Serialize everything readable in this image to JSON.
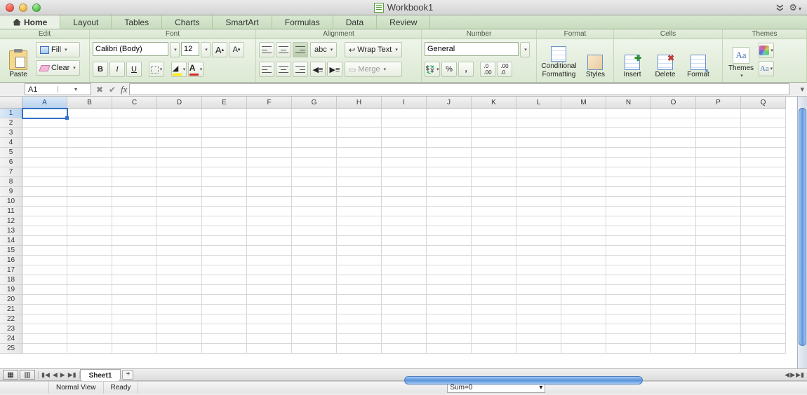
{
  "window": {
    "title": "Workbook1"
  },
  "tabs": [
    "Home",
    "Layout",
    "Tables",
    "Charts",
    "SmartArt",
    "Formulas",
    "Data",
    "Review"
  ],
  "active_tab": "Home",
  "groups": {
    "edit": "Edit",
    "font": "Font",
    "alignment": "Alignment",
    "number": "Number",
    "format": "Format",
    "cells": "Cells",
    "themes": "Themes"
  },
  "edit": {
    "paste": "Paste",
    "fill": "Fill",
    "clear": "Clear"
  },
  "font": {
    "name": "Calibri (Body)",
    "size": "12",
    "bold": "B",
    "italic": "I",
    "underline": "U"
  },
  "alignment": {
    "orientation": "abc",
    "wrap": "Wrap Text",
    "merge": "Merge"
  },
  "number": {
    "format": "General",
    "percent": "%",
    "comma": ","
  },
  "format": {
    "conditional": "Conditional",
    "conditional2": "Formatting",
    "styles": "Styles"
  },
  "cells": {
    "insert": "Insert",
    "delete": "Delete",
    "fmt": "Format"
  },
  "themes": {
    "themes": "Themes",
    "aa": "Aa"
  },
  "namebox": "A1",
  "fx": "fx",
  "columns": [
    "A",
    "B",
    "C",
    "D",
    "E",
    "F",
    "G",
    "H",
    "I",
    "J",
    "K",
    "L",
    "M",
    "N",
    "O",
    "P",
    "Q"
  ],
  "rows": [
    "1",
    "2",
    "3",
    "4",
    "5",
    "6",
    "7",
    "8",
    "9",
    "10",
    "11",
    "12",
    "13",
    "14",
    "15",
    "16",
    "17",
    "18",
    "19",
    "20",
    "21",
    "22",
    "23",
    "24",
    "25"
  ],
  "active_cell": "A1",
  "sheets": {
    "name": "Sheet1",
    "add": "+"
  },
  "status": {
    "view": "Normal View",
    "ready": "Ready",
    "sum": "Sum=0"
  }
}
